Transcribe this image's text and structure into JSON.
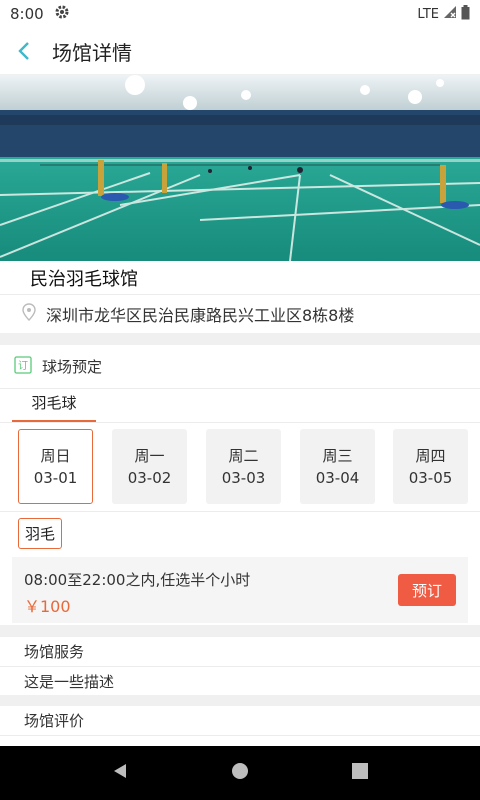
{
  "status_bar": {
    "time": "8:00",
    "network": "LTE"
  },
  "app_bar": {
    "title": "场馆详情"
  },
  "venue": {
    "name": "民治羽毛球馆",
    "address": "深圳市龙华区民治民康路民兴工业区8栋8楼"
  },
  "booking": {
    "section_title": "球场预定",
    "section_icon_text": "订",
    "sport_tabs": [
      {
        "label": "羽毛球",
        "selected": true
      }
    ],
    "days": [
      {
        "weekday": "周日",
        "date": "03-01",
        "selected": true
      },
      {
        "weekday": "周一",
        "date": "03-02",
        "selected": false
      },
      {
        "weekday": "周二",
        "date": "03-03",
        "selected": false
      },
      {
        "weekday": "周三",
        "date": "03-04",
        "selected": false
      },
      {
        "weekday": "周四",
        "date": "03-05",
        "selected": false
      }
    ],
    "court_chip": "羽毛",
    "slot": {
      "description": "08:00至22:00之内,任选半个小时",
      "price": "￥100",
      "button_label": "预订"
    }
  },
  "services": {
    "title": "场馆服务",
    "description": "这是一些描述"
  },
  "reviews": {
    "title": "场馆评价"
  },
  "colors": {
    "accent": "#e8693a",
    "button": "#ef5b43",
    "back_arrow": "#3fb8c8",
    "court": "#1f8f86"
  }
}
